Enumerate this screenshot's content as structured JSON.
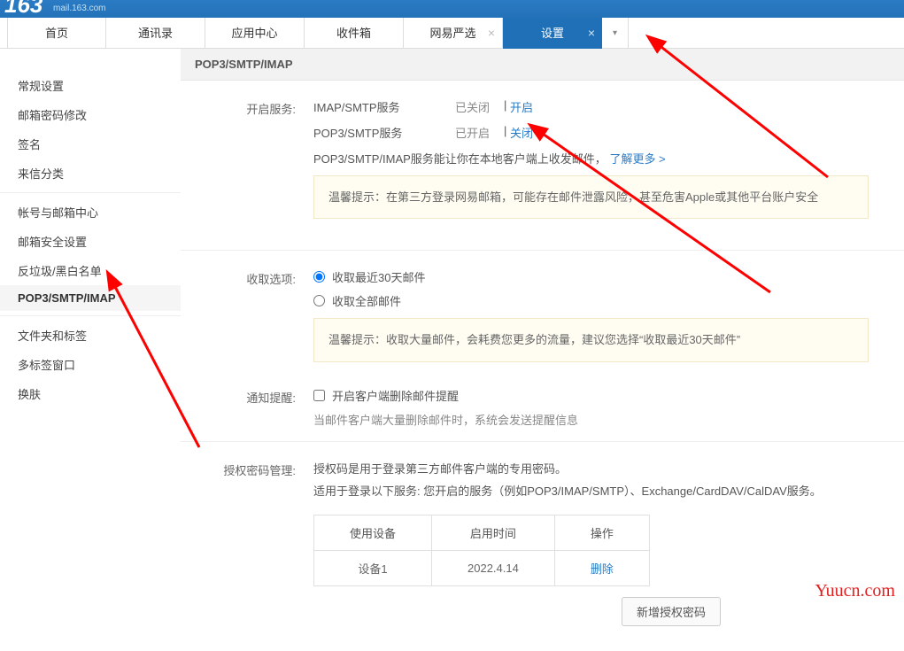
{
  "topbar": {
    "brand_fragment": "163",
    "domain_text": "mail.163.com"
  },
  "tabs": [
    {
      "label": "首页",
      "closable": false
    },
    {
      "label": "通讯录",
      "closable": false
    },
    {
      "label": "应用中心",
      "closable": false
    },
    {
      "label": "收件箱",
      "closable": false
    },
    {
      "label": "网易严选",
      "closable": true
    },
    {
      "label": "设置",
      "closable": true,
      "active": true
    }
  ],
  "tabs_more_glyph": "▾",
  "sidebar": {
    "groups": [
      [
        {
          "label": "常规设置"
        },
        {
          "label": "邮箱密码修改"
        },
        {
          "label": "签名"
        },
        {
          "label": "来信分类"
        }
      ],
      [
        {
          "label": "帐号与邮箱中心"
        },
        {
          "label": "邮箱安全设置"
        },
        {
          "label": "反垃圾/黑白名单"
        },
        {
          "label": "POP3/SMTP/IMAP",
          "active": true
        }
      ],
      [
        {
          "label": "文件夹和标签"
        },
        {
          "label": "多标签窗口"
        },
        {
          "label": "换肤"
        }
      ]
    ]
  },
  "section": {
    "title": "POP3/SMTP/IMAP",
    "service_label": "开启服务:",
    "services": [
      {
        "name": "IMAP/SMTP服务",
        "status": "已关闭",
        "action": "开启"
      },
      {
        "name": "POP3/SMTP服务",
        "status": "已开启",
        "action": "关闭"
      }
    ],
    "service_note_prefix": "POP3/SMTP/IMAP服务能让你在本地客户端上收发邮件，",
    "service_note_link": "了解更多 >",
    "tip1": "温馨提示：在第三方登录网易邮箱，可能存在邮件泄露风险，甚至危害Apple或其他平台账户安全",
    "receive_label": "收取选项:",
    "receive_opts": [
      {
        "label": "收取最近30天邮件",
        "checked": true
      },
      {
        "label": "收取全部邮件",
        "checked": false
      }
    ],
    "tip2": "温馨提示：收取大量邮件，会耗费您更多的流量，建议您选择“收取最近30天邮件”",
    "notify_label": "通知提醒:",
    "notify_check": "开启客户端删除邮件提醒",
    "notify_sub": "当邮件客户端大量删除邮件时，系统会发送提醒信息",
    "auth_label": "授权密码管理:",
    "auth_desc1": "授权码是用于登录第三方邮件客户端的专用密码。",
    "auth_desc2": "适用于登录以下服务: 您开启的服务（例如POP3/IMAP/SMTP）、Exchange/CardDAV/CalDAV服务。",
    "auth_table": {
      "headers": [
        "使用设备",
        "启用时间",
        "操作"
      ],
      "rows": [
        {
          "device": "设备1",
          "time": "2022.4.14",
          "action": "删除"
        }
      ]
    },
    "add_auth_btn": "新增授权密码"
  },
  "watermark": "Yuucn.com"
}
